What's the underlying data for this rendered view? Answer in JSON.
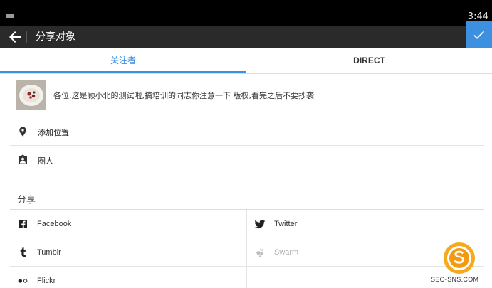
{
  "status_bar": {
    "time": "3:44"
  },
  "action_bar": {
    "title": "分享对象",
    "confirm_icon": "check-icon",
    "back_icon": "arrow-left-icon"
  },
  "tabs": [
    {
      "label": "关注者",
      "active": true
    },
    {
      "label": "DIRECT",
      "active": false
    }
  ],
  "colors": {
    "accent": "#3d8fe0",
    "action_bar": "#2a2a2a",
    "status_bar": "#000000"
  },
  "caption": {
    "text": "各位,这是顾小北的测试啦,搞培训的同志你注意一下 版权,看完之后不要抄袭"
  },
  "options": {
    "location": {
      "icon": "location-pin-icon",
      "label": "添加位置"
    },
    "people": {
      "icon": "person-badge-icon",
      "label": "圈人"
    }
  },
  "share": {
    "title": "分享",
    "services": [
      {
        "name": "Facebook",
        "icon": "facebook-icon",
        "enabled": true
      },
      {
        "name": "Twitter",
        "icon": "twitter-icon",
        "enabled": true
      },
      {
        "name": "Tumblr",
        "icon": "tumblr-icon",
        "enabled": true
      },
      {
        "name": "Swarm",
        "icon": "swarm-icon",
        "enabled": false
      },
      {
        "name": "Flickr",
        "icon": "flickr-icon",
        "enabled": true
      }
    ]
  },
  "watermark": {
    "text": "SEO-SNS.COM"
  }
}
